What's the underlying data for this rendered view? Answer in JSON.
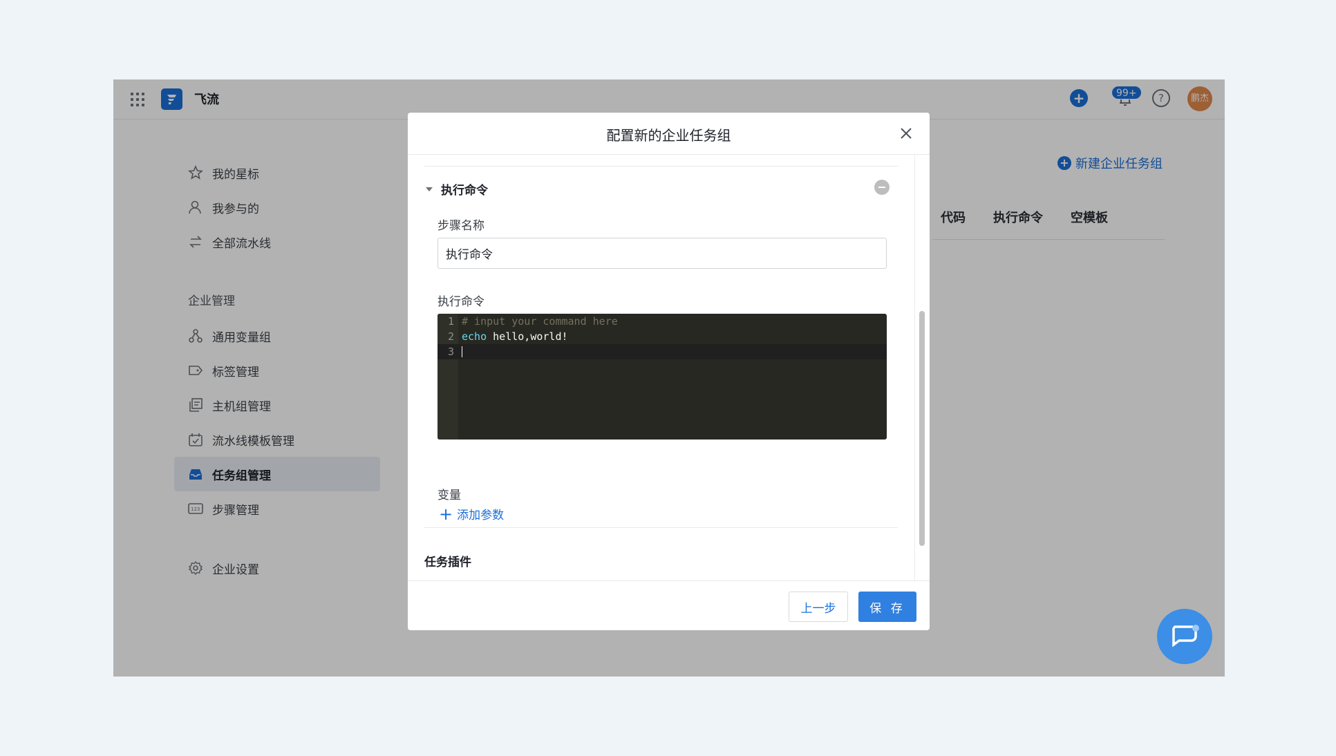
{
  "app": {
    "title": "飞流",
    "badge": "99+",
    "avatar_text": "鹏杰"
  },
  "sidebar": {
    "items_top": [
      {
        "label": "我的星标",
        "icon": "star-icon"
      },
      {
        "label": "我参与的",
        "icon": "user-icon"
      },
      {
        "label": "全部流水线",
        "icon": "pipeline-icon"
      }
    ],
    "heading": "企业管理",
    "items_mgmt": [
      {
        "label": "通用变量组",
        "icon": "variable-group-icon"
      },
      {
        "label": "标签管理",
        "icon": "tag-icon"
      },
      {
        "label": "主机组管理",
        "icon": "host-group-icon"
      },
      {
        "label": "流水线模板管理",
        "icon": "template-icon"
      },
      {
        "label": "任务组管理",
        "icon": "inbox-icon",
        "active": true
      },
      {
        "label": "步骤管理",
        "icon": "steps-icon"
      }
    ],
    "settings": {
      "label": "企业设置",
      "icon": "gear-icon"
    }
  },
  "main": {
    "new_button": "新建企业任务组",
    "tabs": [
      "代码",
      "执行命令",
      "空模板"
    ]
  },
  "modal": {
    "title": "配置新的企业任务组",
    "step_title": "执行命令",
    "step_name_label": "步骤名称",
    "step_name_value": "执行命令",
    "command_label": "执行命令",
    "code_lines": [
      {
        "num": "1",
        "comment": "# input your command here"
      },
      {
        "num": "2",
        "keyword": "echo",
        "text": " hello,world!"
      },
      {
        "num": "3",
        "text": ""
      }
    ],
    "variables_label": "变量",
    "add_param": "添加参数",
    "plugin_title": "任务插件",
    "prev_button": "上一步",
    "save_button": "保 存"
  },
  "colors": {
    "accent": "#1b6fd8",
    "save": "#2f80e0",
    "editor_bg": "#272822",
    "page_bg": "#eff4f9"
  }
}
